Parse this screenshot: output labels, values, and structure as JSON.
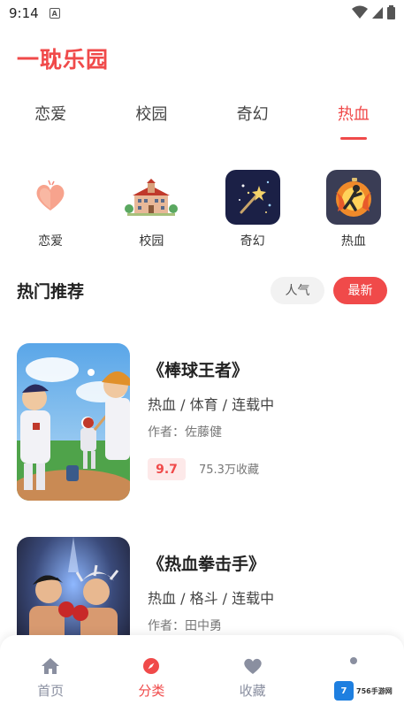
{
  "status_bar": {
    "time": "9:14"
  },
  "app": {
    "title": "一耽乐园"
  },
  "tabs": [
    {
      "label": "恋爱",
      "active": false
    },
    {
      "label": "校园",
      "active": false
    },
    {
      "label": "奇幻",
      "active": false
    },
    {
      "label": "热血",
      "active": true
    }
  ],
  "categories": [
    {
      "label": "恋爱",
      "icon": "heart-icon"
    },
    {
      "label": "校园",
      "icon": "school-building-icon"
    },
    {
      "label": "奇幻",
      "icon": "magic-wand-icon"
    },
    {
      "label": "热血",
      "icon": "flame-figure-icon"
    }
  ],
  "section": {
    "title": "热门推荐",
    "sort_popular": "人气",
    "sort_newest": "最新"
  },
  "books": [
    {
      "title": "《棒球王者》",
      "tags": "热血 / 体育 / 连载中",
      "author": "作者：佐藤健",
      "score": "9.7",
      "favorites": "75.3万收藏"
    },
    {
      "title": "《热血拳击手》",
      "tags": "热血 / 格斗 / 连载中",
      "author": "作者：田中勇"
    }
  ],
  "bottom_nav": [
    {
      "label": "首页",
      "icon": "home-icon",
      "active": false
    },
    {
      "label": "分类",
      "icon": "compass-icon",
      "active": true
    },
    {
      "label": "收藏",
      "icon": "heart-icon",
      "active": false
    }
  ],
  "watermark": {
    "text": "756手游网",
    "logo": "7"
  },
  "colors": {
    "accent": "#f04a4a",
    "nav_inactive": "#8a8fa0"
  }
}
